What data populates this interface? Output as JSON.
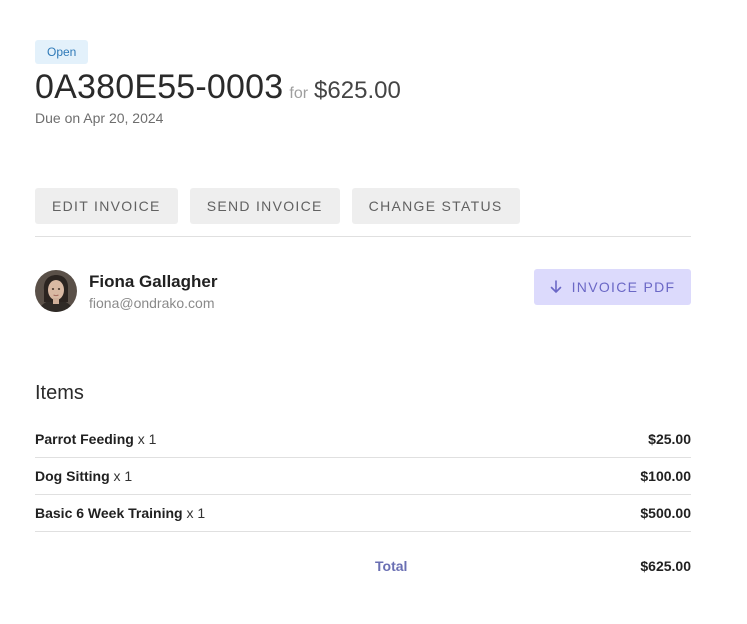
{
  "invoice": {
    "status": "Open",
    "number": "0A380E55-0003",
    "for_text": "for",
    "amount": "$625.00",
    "due": "Due on Apr 20, 2024"
  },
  "actions": {
    "edit_label": "EDIT INVOICE",
    "send_label": "SEND INVOICE",
    "change_status_label": "CHANGE STATUS"
  },
  "customer": {
    "name": "Fiona Gallagher",
    "email": "fiona@ondrako.com"
  },
  "pdf_button": {
    "label": "INVOICE PDF",
    "icon": "arrow-down-icon"
  },
  "items": {
    "heading": "Items",
    "rows": [
      {
        "name": "Parrot Feeding",
        "qty": "x 1",
        "price": "$25.00"
      },
      {
        "name": "Dog Sitting",
        "qty": "x 1",
        "price": "$100.00"
      },
      {
        "name": "Basic 6 Week Training",
        "qty": "x 1",
        "price": "$500.00"
      }
    ]
  },
  "total": {
    "label": "Total",
    "value": "$625.00"
  },
  "colors": {
    "badge_bg": "#e3f1fb",
    "badge_text": "#2f7ab8",
    "pdf_bg": "#dcdafc",
    "pdf_text": "#6b68c6",
    "total_label": "#6a6fb3"
  }
}
